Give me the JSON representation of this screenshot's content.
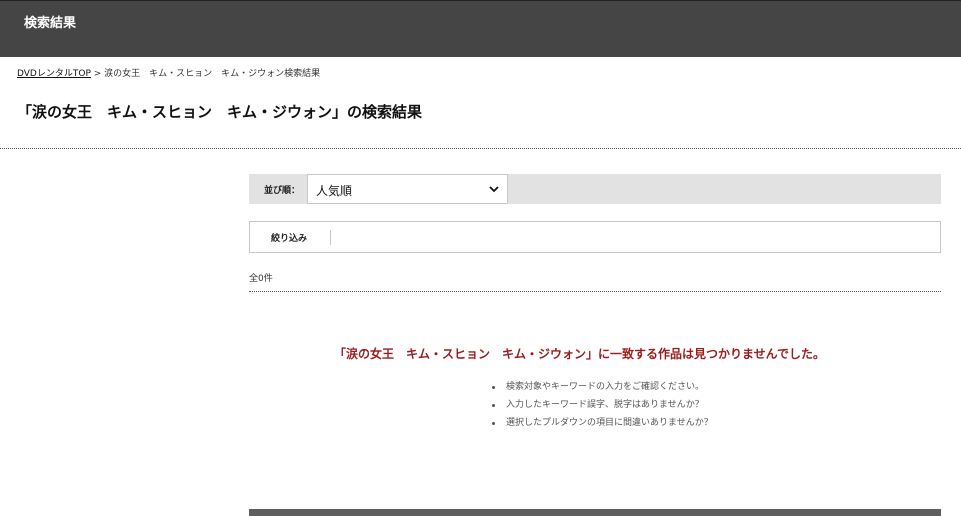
{
  "header": {
    "title": "検索結果"
  },
  "breadcrumb": {
    "home_label": "DVDレンタルTOP",
    "separator": ">",
    "current": "涙の女王　キム・スヒョン　キム・ジウォン検索結果"
  },
  "page_title": "「涙の女王　キム・スヒョン　キム・ジウォン」の検索結果",
  "sort": {
    "label": "並び順：",
    "selected": "人気順"
  },
  "filter": {
    "label": "絞り込み"
  },
  "result_count": "全0件",
  "no_result": {
    "message": "「涙の女王　キム・スヒョン　キム・ジウォン」に一致する作品は見つかりませんでした。",
    "hints": [
      "検索対象やキーワードの入力をご確認ください。",
      "入力したキーワード誤字、脱字はありませんか？",
      "選択したプルダウンの項目に間違いありませんか？"
    ]
  },
  "colors": {
    "header_bg": "#454545",
    "error_text": "#9b1c1c",
    "sortbar_bg": "#e2e2e2"
  }
}
